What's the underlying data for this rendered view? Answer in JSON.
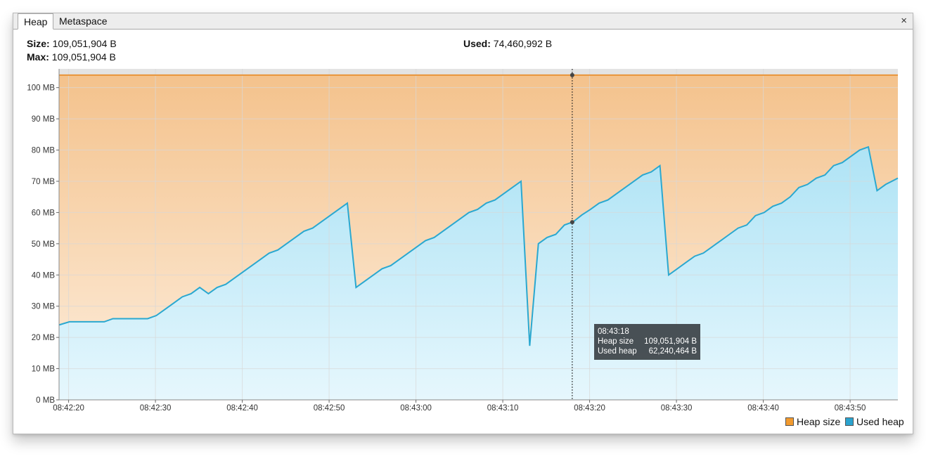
{
  "tabs": [
    {
      "label": "Heap",
      "active": true
    },
    {
      "label": "Metaspace",
      "active": false
    }
  ],
  "close_label": "×",
  "stats": {
    "size_label": "Size:",
    "size_value": "109,051,904 B",
    "max_label": "Max:",
    "max_value": "109,051,904 B",
    "used_label": "Used:",
    "used_value": "74,460,992 B"
  },
  "tooltip": {
    "time": "08:43:18",
    "heap_label": "Heap size",
    "heap_value": "109,051,904 B",
    "used_label": "Used heap",
    "used_value": "62,240,464 B"
  },
  "legend": {
    "heap_label": "Heap size",
    "used_label": "Used heap"
  },
  "colors": {
    "heap_line": "#e8943a",
    "heap_fill_top": "#f4c28c",
    "heap_fill_bottom": "#fdeedd",
    "used_line": "#2aa8d0",
    "used_fill_top": "#aee3f5",
    "used_fill_bottom": "#e6f7fd",
    "grid": "#d8d8d8",
    "heap_swatch": "#f29a2e",
    "used_swatch": "#2aa3cf"
  },
  "chart_data": {
    "type": "area",
    "xlabel": "",
    "ylabel": "",
    "x_ticks": [
      "08:42:20",
      "08:42:30",
      "08:42:40",
      "08:42:50",
      "08:43:00",
      "08:43:10",
      "08:43:20",
      "08:43:30",
      "08:43:40",
      "08:43:50"
    ],
    "y_ticks": [
      "0 MB",
      "10 MB",
      "20 MB",
      "30 MB",
      "40 MB",
      "50 MB",
      "60 MB",
      "70 MB",
      "80 MB",
      "90 MB",
      "100 MB"
    ],
    "ylim": [
      0,
      106
    ],
    "xlim": [
      "08:42:18.9",
      "08:43:55.5"
    ],
    "grid": true,
    "legend_position": "bottom-right",
    "crosshair_time": "08:43:18",
    "series": [
      {
        "name": "Heap size",
        "x": [
          "08:42:18.9",
          "08:43:55.5"
        ],
        "values": [
          104,
          104
        ]
      },
      {
        "name": "Used heap",
        "x": [
          "08:42:18.9",
          "08:42:20.1",
          "08:42:21.1",
          "08:42:24.1",
          "08:42:25.1",
          "08:42:29.1",
          "08:42:30.1",
          "08:42:31.1",
          "08:42:32.1",
          "08:42:33.1",
          "08:42:34.1",
          "08:42:35.1",
          "08:42:36.1",
          "08:42:37.1",
          "08:42:38.1",
          "08:42:39.1",
          "08:42:40.1",
          "08:42:41.1",
          "08:42:42.1",
          "08:42:43.1",
          "08:42:44.1",
          "08:42:45.1",
          "08:42:46.1",
          "08:42:47.1",
          "08:42:48.1",
          "08:42:49.1",
          "08:42:50.1",
          "08:42:51.1",
          "08:42:52.1",
          "08:42:53.1",
          "08:42:54.1",
          "08:42:55.1",
          "08:42:56.1",
          "08:42:57.1",
          "08:42:58.1",
          "08:42:59.1",
          "08:43:00.1",
          "08:43:01.1",
          "08:43:02.1",
          "08:43:03.1",
          "08:43:04.1",
          "08:43:05.1",
          "08:43:06.1",
          "08:43:07.1",
          "08:43:08.1",
          "08:43:09.1",
          "08:43:10.1",
          "08:43:11.1",
          "08:43:12.1",
          "08:43:13.1",
          "08:43:14.1",
          "08:43:15.1",
          "08:43:16.1",
          "08:43:17.1",
          "08:43:18.1",
          "08:43:19.1",
          "08:43:20.1",
          "08:43:21.1",
          "08:43:22.1",
          "08:43:23.1",
          "08:43:24.1",
          "08:43:25.1",
          "08:43:26.1",
          "08:43:27.1",
          "08:43:28.1",
          "08:43:29.1",
          "08:43:30.1",
          "08:43:31.1",
          "08:43:32.1",
          "08:43:33.1",
          "08:43:34.1",
          "08:43:35.1",
          "08:43:36.1",
          "08:43:37.1",
          "08:43:38.1",
          "08:43:39.1",
          "08:43:40.1",
          "08:43:41.1",
          "08:43:42.1",
          "08:43:43.1",
          "08:43:44.1",
          "08:43:45.1",
          "08:43:46.1",
          "08:43:47.1",
          "08:43:48.1",
          "08:43:49.1",
          "08:43:50.1",
          "08:43:51.1",
          "08:43:52.1",
          "08:43:53.1",
          "08:43:54.1",
          "08:43:55.5"
        ],
        "values": [
          24.0,
          25.0,
          25.0,
          25.0,
          26.0,
          26.0,
          27.0,
          29.0,
          31.0,
          33.0,
          34.0,
          36.0,
          34.0,
          36.0,
          37.0,
          39.0,
          41.0,
          43.0,
          45.0,
          47.0,
          48.0,
          50.0,
          52.0,
          54.0,
          55.0,
          57.0,
          59.0,
          61.0,
          63.0,
          36.0,
          38.0,
          40.0,
          42.0,
          43.0,
          45.0,
          47.0,
          49.0,
          51.0,
          52.0,
          54.0,
          56.0,
          58.0,
          60.0,
          61.0,
          63.0,
          64.0,
          66.0,
          68.0,
          70.0,
          17.3,
          50.0,
          52.0,
          53.0,
          56.0,
          57.0,
          59.2,
          61.0,
          63.0,
          64.0,
          66.0,
          68.0,
          70.0,
          72.0,
          73.0,
          75.0,
          40.0,
          42.0,
          44.0,
          46.0,
          47.0,
          49.0,
          51.0,
          53.0,
          55.0,
          56.0,
          59.0,
          60.0,
          62.0,
          63.0,
          65.0,
          68.0,
          69.0,
          71.0,
          72.0,
          75.0,
          76.0,
          78.0,
          80.0,
          81.0,
          67.0,
          69.0,
          71.0
        ]
      }
    ]
  }
}
